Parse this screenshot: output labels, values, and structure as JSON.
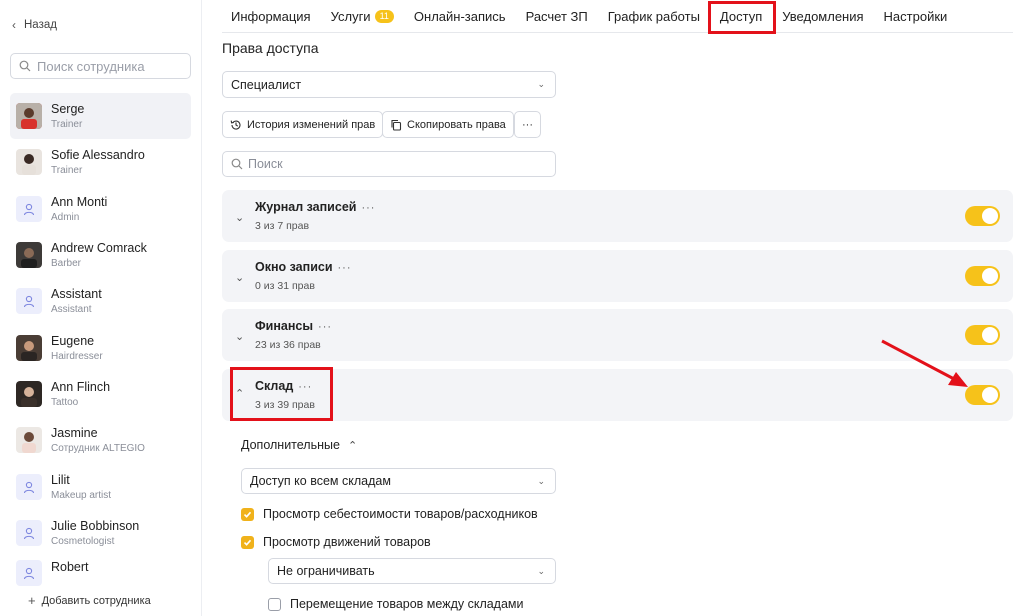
{
  "sidebar": {
    "back_label": "Назад",
    "search_placeholder": "Поиск сотрудника",
    "employees": [
      {
        "name": "Serge",
        "role": "Trainer"
      },
      {
        "name": "Sofie Alessandro",
        "role": "Trainer"
      },
      {
        "name": "Ann Monti",
        "role": "Admin"
      },
      {
        "name": "Andrew Comrack",
        "role": "Barber"
      },
      {
        "name": "Assistant",
        "role": "Assistant"
      },
      {
        "name": "Eugene",
        "role": "Hairdresser"
      },
      {
        "name": "Ann Flinch",
        "role": "Tattoo"
      },
      {
        "name": "Jasmine",
        "role": "Сотрудник ALTEGIO"
      },
      {
        "name": "Lilit",
        "role": "Makeup artist"
      },
      {
        "name": "Julie Bobbinson",
        "role": "Cosmetologist"
      },
      {
        "name": "Robert",
        "role": ""
      }
    ],
    "add_label": "Добавить сотрудника"
  },
  "tabs": [
    {
      "label": "Информация"
    },
    {
      "label": "Услуги",
      "badge": "11"
    },
    {
      "label": "Онлайн-запись"
    },
    {
      "label": "Расчет ЗП"
    },
    {
      "label": "График работы"
    },
    {
      "label": "Доступ"
    },
    {
      "label": "Уведомления"
    },
    {
      "label": "Настройки"
    }
  ],
  "main": {
    "title": "Права доступа",
    "role_select": "Специалист",
    "history_button": "История изменений прав",
    "copy_button": "Скопировать права",
    "more_button": "···",
    "search_placeholder": "Поиск",
    "categories": [
      {
        "title": "Журнал записей",
        "dots": "···",
        "sub": "3 из 7 прав",
        "enabled": true
      },
      {
        "title": "Окно записи",
        "dots": "···",
        "sub": "0 из 31 прав",
        "enabled": true
      },
      {
        "title": "Финансы",
        "dots": "···",
        "sub": "23 из 36 прав",
        "enabled": true
      },
      {
        "title": "Склад",
        "dots": "···",
        "sub": "3 из 39 прав",
        "enabled": true
      }
    ],
    "additional_label": "Дополнительные",
    "warehouse_select": "Доступ ко всем складам",
    "checkbox_cost": "Просмотр себестоимости товаров/расходников",
    "checkbox_movements": "Просмотр движений товаров",
    "movements_select": "Не ограничивать",
    "checkbox_transfer": "Перемещение товаров между складами"
  },
  "colors": {
    "accent": "#f6c21a",
    "highlight": "#e3111a",
    "card_bg": "#f3f4f7"
  }
}
